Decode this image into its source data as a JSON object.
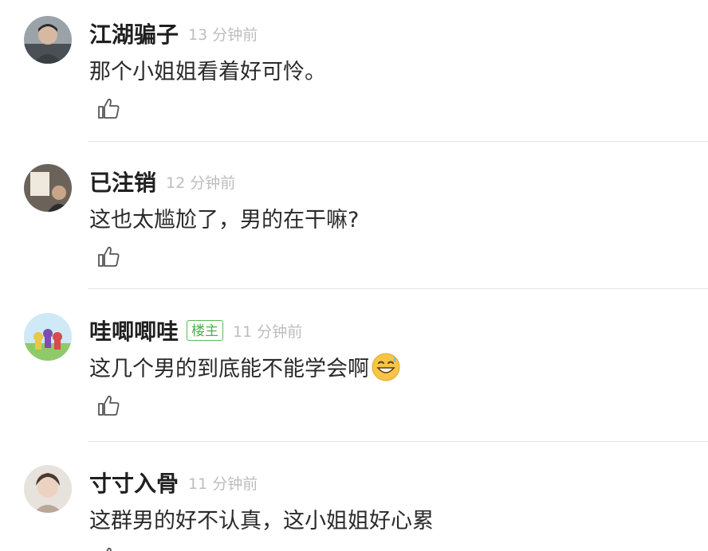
{
  "comments": [
    {
      "username": "江湖骗子",
      "time": "13 分钟前",
      "content": "那个小姐姐看着好可怜。",
      "badge": "",
      "emoji": ""
    },
    {
      "username": "已注销",
      "time": "12 分钟前",
      "content": "这也太尴尬了，男的在干嘛?",
      "badge": "",
      "emoji": ""
    },
    {
      "username": "哇唧唧哇",
      "time": "11 分钟前",
      "content": "这几个男的到底能不能学会啊",
      "badge": "楼主",
      "emoji": "grinning-sweat-emoji"
    },
    {
      "username": "寸寸入骨",
      "time": "11 分钟前",
      "content": "这群男的好不认真，这小姐姐好心累",
      "badge": "",
      "emoji": ""
    }
  ],
  "icons": {
    "like": "thumbs-up-icon"
  },
  "colors": {
    "badge": "#4caf50",
    "time": "#bdbdbd",
    "divider": "#e3e3e3"
  }
}
